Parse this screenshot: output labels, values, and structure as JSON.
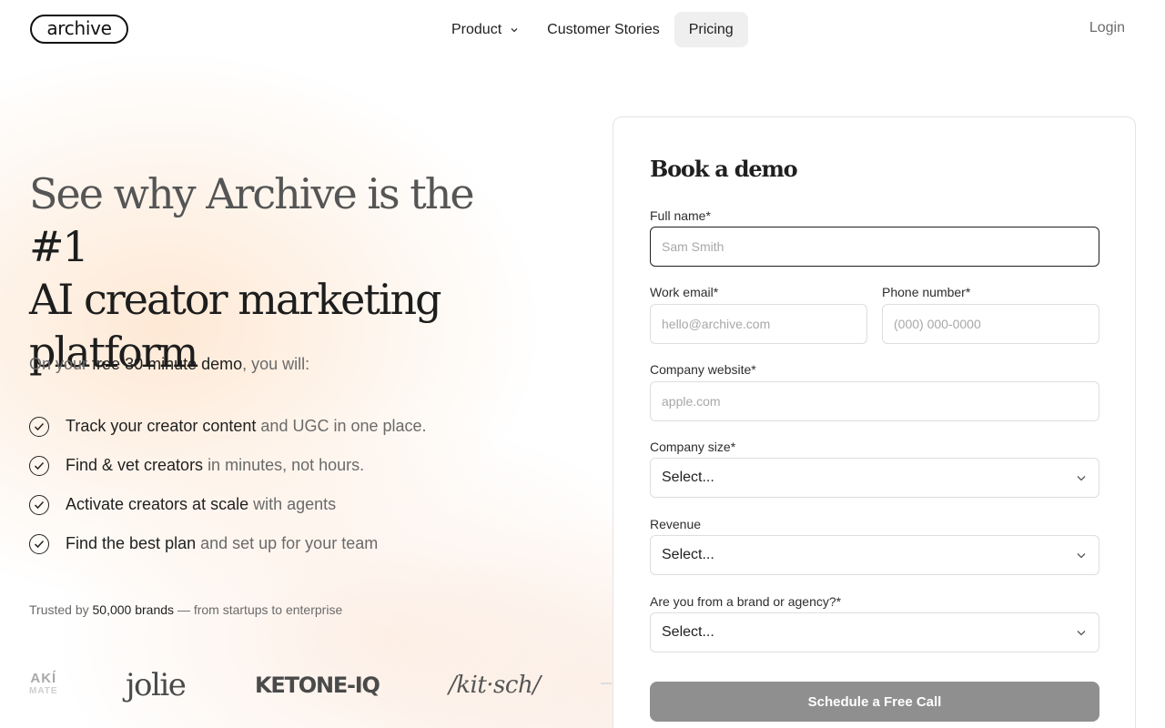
{
  "header": {
    "logo_text": "archive",
    "nav": [
      {
        "label": "Product",
        "has_dropdown": true,
        "active": false
      },
      {
        "label": "Customer Stories",
        "has_dropdown": false,
        "active": false
      },
      {
        "label": "Pricing",
        "has_dropdown": false,
        "active": true
      }
    ],
    "login_label": "Login"
  },
  "hero": {
    "headline_muted": "See why Archive is the",
    "headline_strong_1": "#1",
    "headline_strong_2": "AI creator marketing",
    "headline_strong_3": "platform",
    "intro_prefix": "On your",
    "intro_bold": "free 30 minute demo",
    "intro_suffix": ", you will:",
    "benefits": [
      {
        "bold": "Track your creator content",
        "rest": "and UGC in one place."
      },
      {
        "bold": "Find & vet creators",
        "rest": "in minutes, not hours."
      },
      {
        "bold": "Activate creators at scale",
        "rest": "with agents"
      },
      {
        "bold": "Find the best plan",
        "rest": "and set up for your team"
      }
    ],
    "trusted_prefix": "Trusted by",
    "trusted_bold": "50,000 brands",
    "trusted_suffix": "— from startups to enterprise",
    "brand_logos": [
      {
        "name": "aki-logo",
        "line1": "AKÍ",
        "line2": "MATE"
      },
      {
        "name": "jolie-logo",
        "text": "jolie"
      },
      {
        "name": "ketone-iq-logo",
        "text": "KETONE-IQ"
      },
      {
        "name": "kitsch-logo",
        "text": "/kit·sch/"
      }
    ]
  },
  "form": {
    "title": "Book a demo",
    "full_name": {
      "label": "Full name*",
      "placeholder": "Sam Smith"
    },
    "work_email": {
      "label": "Work email*",
      "placeholder": "hello@archive.com"
    },
    "phone": {
      "label": "Phone number*",
      "placeholder": "(000) 000-0000"
    },
    "website": {
      "label": "Company website*",
      "placeholder": "apple.com"
    },
    "company_size": {
      "label": "Company size*",
      "value": "Select..."
    },
    "revenue": {
      "label": "Revenue",
      "value": "Select..."
    },
    "brand_or_agency": {
      "label": "Are you from a brand or agency?*",
      "value": "Select..."
    },
    "submit_label": "Schedule a Free Call"
  },
  "colors": {
    "submit_bg": "#8f8f8f",
    "active_nav_bg": "#efefef",
    "hero_glow": "#fcd6b2"
  }
}
